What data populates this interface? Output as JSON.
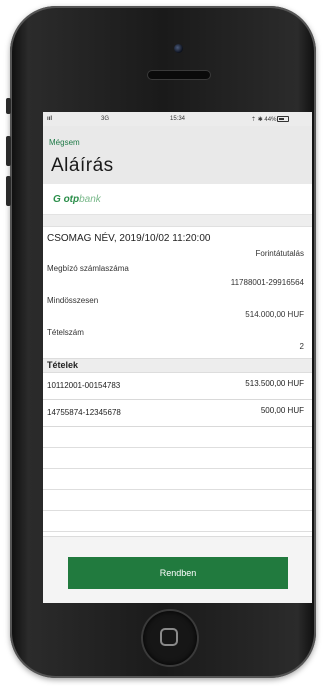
{
  "status_bar": {
    "signal": "ııl",
    "network": "3G",
    "time": "15:34",
    "right": "⇡ ✱ 44%"
  },
  "header": {
    "back_label": "Mégsem",
    "title": "Aláírás"
  },
  "logo": {
    "mark": "G",
    "brand_main": "otp",
    "brand_sub": "bank"
  },
  "package": {
    "name": "CSOMAG NÉV, 2019/10/02 11:20:00",
    "type": "Forintátutalás"
  },
  "details": [
    {
      "label": "Megbízó számlaszáma",
      "value": "11788001-29916564"
    },
    {
      "label": "Mindösszesen",
      "value": "514.000,00 HUF"
    },
    {
      "label": "Tételszám",
      "value": "2"
    }
  ],
  "items_header": "Tételek",
  "items": [
    {
      "account": "10112001-00154783",
      "amount": "513.500,00 HUF"
    },
    {
      "account": "14755874-12345678",
      "amount": "500,00 HUF"
    }
  ],
  "footer": {
    "ok_label": "Rendben"
  },
  "colors": {
    "accent_green": "#217a3e",
    "link_green": "#1f7a47"
  }
}
